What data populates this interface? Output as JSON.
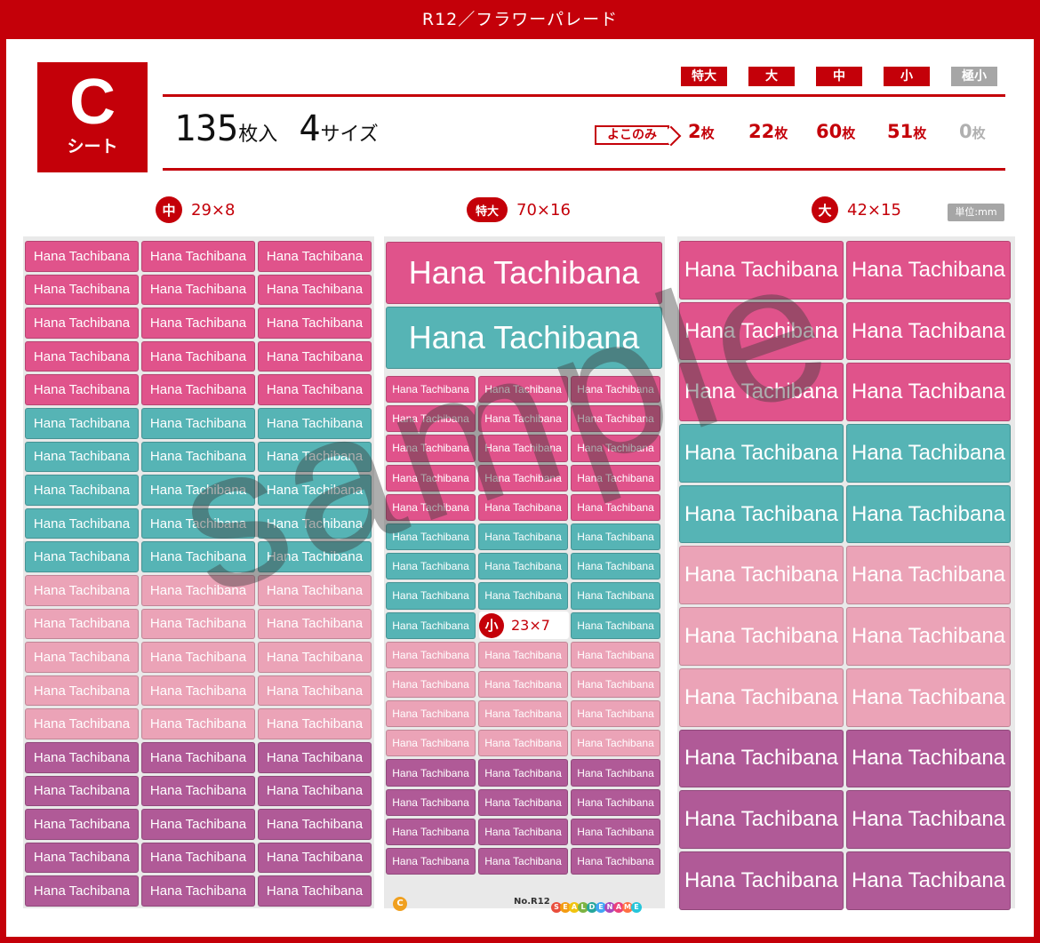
{
  "title": "R12／フラワーパレード",
  "sheet": {
    "letter": "C",
    "label": "シート"
  },
  "total": {
    "number": "135",
    "count_unit": "枚入",
    "sizes_number": "4",
    "sizes_unit": "サイズ"
  },
  "sizes": [
    {
      "label": "特大",
      "count": "2",
      "unit": "枚",
      "active": true
    },
    {
      "label": "大",
      "count": "22",
      "unit": "枚",
      "active": true
    },
    {
      "label": "中",
      "count": "60",
      "unit": "枚",
      "active": true
    },
    {
      "label": "小",
      "count": "51",
      "unit": "枚",
      "active": true
    },
    {
      "label": "極小",
      "count": "0",
      "unit": "枚",
      "active": false
    }
  ],
  "yoko_label": "よこのみ",
  "unit_badge": "単位:mm",
  "sections": {
    "chu": {
      "badge": "中",
      "dims": "29×8"
    },
    "tokudai": {
      "badge": "特大",
      "dims": "70×16"
    },
    "dai": {
      "badge": "大",
      "dims": "42×15"
    },
    "sho": {
      "badge": "小",
      "dims": "23×7"
    }
  },
  "name_text": "Hana Tachibana",
  "watermark": "sample",
  "footer": {
    "badge": "C",
    "model": "No.R12",
    "brand": "SEALDENAME"
  },
  "colors": {
    "red": "#c40009",
    "pink": "#e0538b",
    "teal": "#56b4b5",
    "light_pink": "#eba3b7",
    "purple": "#b05a97"
  }
}
